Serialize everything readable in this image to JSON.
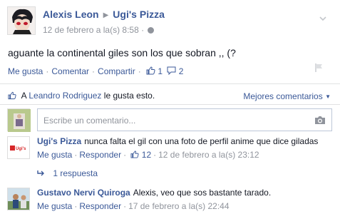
{
  "post": {
    "author": "Alexis Leon",
    "page": "Ugi's Pizza",
    "timestamp": "12 de febrero a la(s) 8:58",
    "text": "aguante la continental giles son los que sobran ,, (?",
    "actions": {
      "like": "Me gusta",
      "comment": "Comentar",
      "share": "Compartir",
      "like_count": "1",
      "comment_count": "2"
    }
  },
  "likes": {
    "prefix": "A",
    "name": "Leandro Rodriguez",
    "suffix": "le gusta esto."
  },
  "sort": {
    "label": "Mejores comentarios"
  },
  "compose": {
    "placeholder": "Escribe un comentario..."
  },
  "comments": [
    {
      "author": "Ugi's Pizza",
      "text": "nunca falta el gil con una foto de perfil anime que dice giladas",
      "like": "Me gusta",
      "reply": "Responder",
      "like_count": "12",
      "timestamp": "12 de febrero a la(s) 23:12",
      "replies_label": "1 respuesta"
    },
    {
      "author": "Gustavo Nervi Quiroga",
      "text": "Alexis, veo que sos bastante tarado.",
      "like": "Me gusta",
      "reply": "Responder",
      "timestamp": "17 de febrero a la(s) 22:44"
    }
  ],
  "colors": {
    "link": "#3b5998",
    "meta": "#90949c",
    "text": "#141823",
    "divider": "#e1e2e3"
  }
}
